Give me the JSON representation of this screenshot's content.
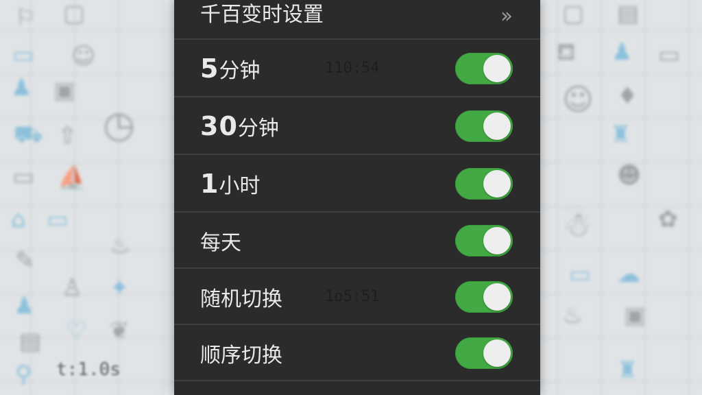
{
  "header": {
    "title": "千百变时设置",
    "more_icon": "double-chevron-right-icon"
  },
  "rows": [
    {
      "num": "5",
      "text": "分钟",
      "ghost": "110:54",
      "on": true
    },
    {
      "num": "30",
      "text": "分钟",
      "ghost": "",
      "on": true
    },
    {
      "num": "1",
      "text": "小时",
      "ghost": "",
      "on": true
    },
    {
      "num": "",
      "text": "每天",
      "ghost": "",
      "on": true
    },
    {
      "num": "",
      "text": "随机切换",
      "ghost": "1o5:51",
      "on": true
    },
    {
      "num": "",
      "text": "顺序切换",
      "ghost": "",
      "on": true
    }
  ],
  "background": {
    "tag_text": "t:1.0s"
  },
  "colors": {
    "panel": "#2b2b2c",
    "toggle_on": "#43a944",
    "knob": "#eeeeee",
    "text": "#e9e9e9"
  }
}
